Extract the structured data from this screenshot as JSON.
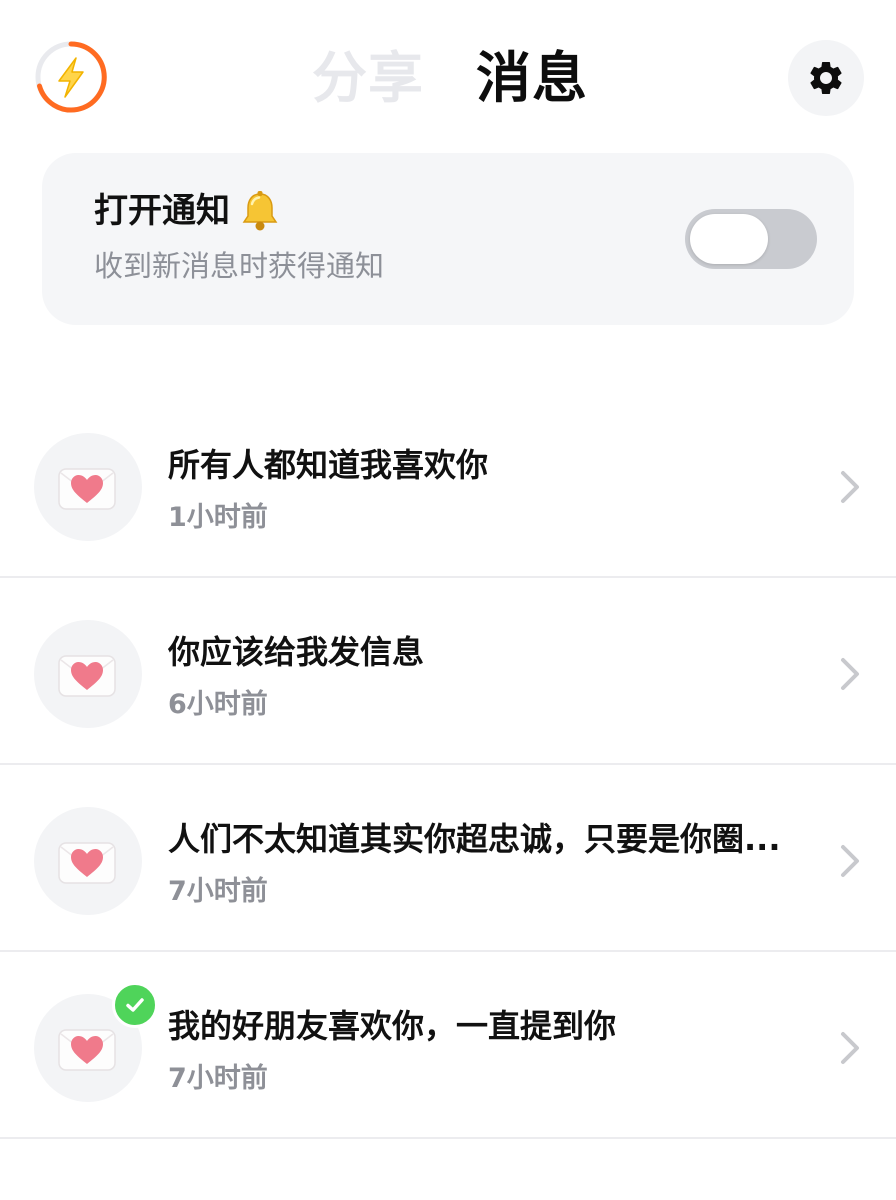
{
  "header": {
    "tabs": [
      {
        "label": "分享",
        "active": false
      },
      {
        "label": "消息",
        "active": true
      }
    ],
    "boost_icon": "lightning-bolt-icon",
    "settings_icon": "gear-icon"
  },
  "notify_card": {
    "title": "打开通知",
    "title_icon": "bell-icon",
    "subtitle": "收到新消息时获得通知",
    "toggle_on": false
  },
  "messages": [
    {
      "title": "所有人都知道我喜欢你",
      "time": "1小时前",
      "read": false
    },
    {
      "title": "你应该给我发信息",
      "time": "6小时前",
      "read": false
    },
    {
      "title": "人们不太知道其实你超忠诚，只要是你圈...",
      "time": "7小时前",
      "read": false
    },
    {
      "title": "我的好朋友喜欢你，一直提到你",
      "time": "7小时前",
      "read": true
    }
  ],
  "colors": {
    "accent_orange": "#ff6b21",
    "toggle_off": "#c9cbd0",
    "check_green": "#4fd45a",
    "heart_pink": "#f07a8b"
  }
}
